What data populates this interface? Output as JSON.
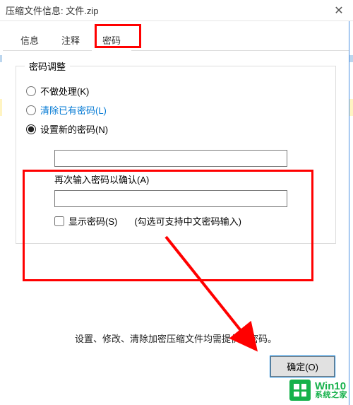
{
  "window": {
    "title": "压缩文件信息: 文件.zip",
    "close_glyph": "✕"
  },
  "tabs": {
    "info": "信息",
    "comment": "注释",
    "password": "密码"
  },
  "fieldset": {
    "legend": "密码调整",
    "opt_none": "不做处理(K)",
    "opt_clear": "清除已有密码(L)",
    "opt_set": "设置新的密码(N)"
  },
  "password_section": {
    "password_value": "",
    "confirm_label": "再次输入密码以确认(A)",
    "confirm_value": "",
    "show_password_label": "显示密码(S)",
    "hint": "(勾选可支持中文密码输入)"
  },
  "footer_note": "设置、修改、清除加密压缩文件均需提供原密码。",
  "buttons": {
    "ok": "确定(O)"
  },
  "watermark": {
    "line1": "Win10",
    "line2": "系统之家"
  },
  "annotation": {
    "highlighted_tab": "password",
    "highlighted_section": "set-password",
    "arrow_color": "#ff0000"
  }
}
